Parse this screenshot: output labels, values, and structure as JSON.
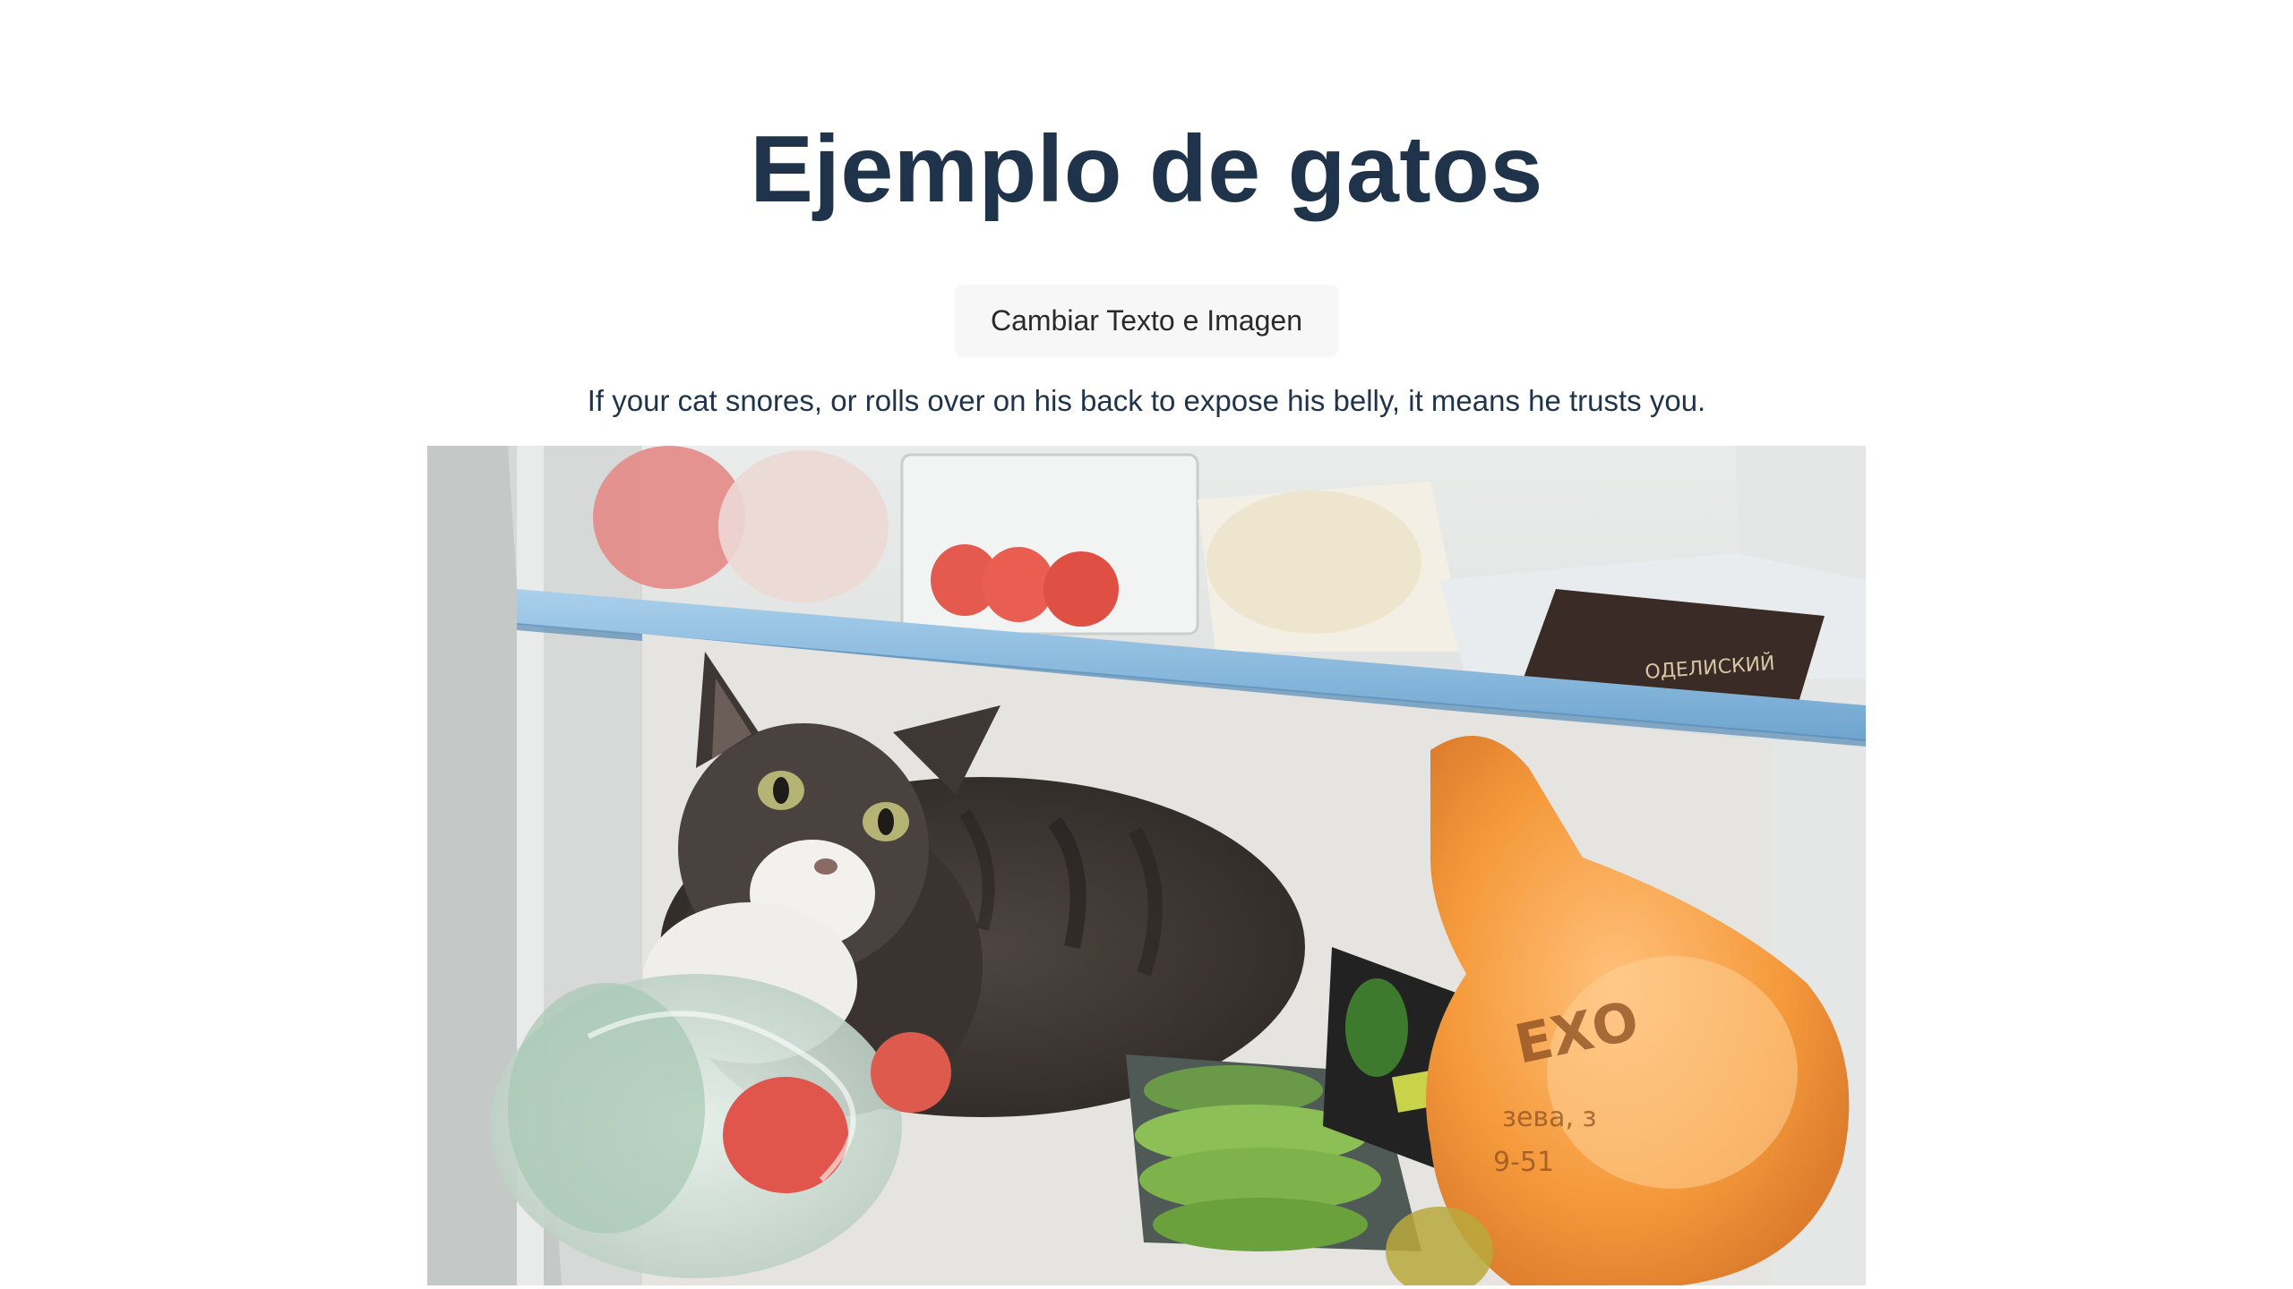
{
  "page": {
    "title": "Ejemplo de gatos",
    "button_label": "Cambiar Texto e Imagen",
    "fact": "If your cat snores, or rolls over on his back to expose his belly, it means he trusts you."
  },
  "photo": {
    "subject": "cat-in-fridge-photo"
  },
  "colors": {
    "title": "#1f334a",
    "button_bg": "#f7f7f7",
    "text": "#1f334a",
    "background": "#ffffff"
  }
}
